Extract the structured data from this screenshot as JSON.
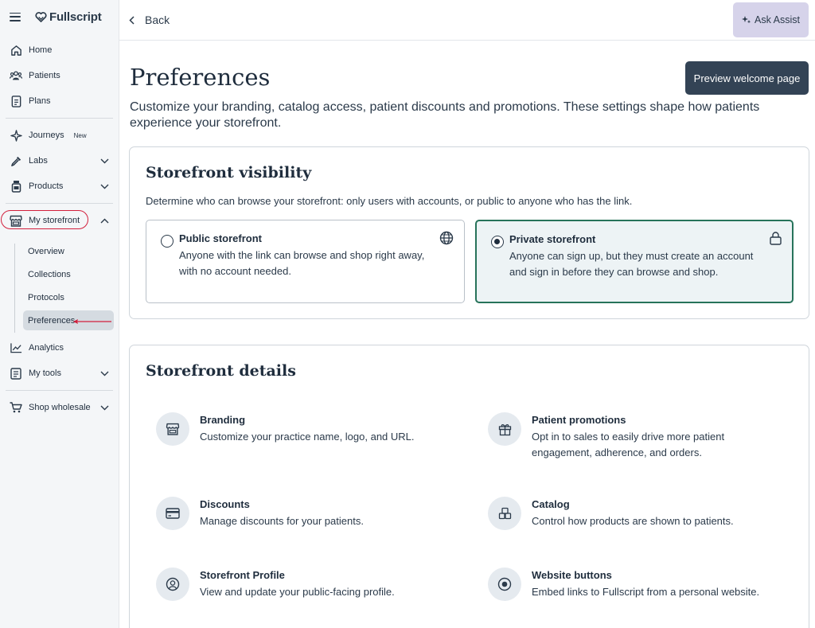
{
  "app": {
    "logo_text": "Fullscript"
  },
  "sidebar": {
    "items": [
      {
        "label": "Home",
        "icon": "home-icon"
      },
      {
        "label": "Patients",
        "icon": "users-icon"
      },
      {
        "label": "Plans",
        "icon": "document-icon"
      },
      {
        "label": "Journeys",
        "icon": "sparkle-icon",
        "badge": "New"
      },
      {
        "label": "Labs",
        "icon": "pipette-icon"
      },
      {
        "label": "Products",
        "icon": "bottle-icon"
      },
      {
        "label": "My storefront",
        "icon": "storefront-icon"
      },
      {
        "label": "Analytics",
        "icon": "line-chart-icon"
      },
      {
        "label": "My tools",
        "icon": "tools-icon"
      },
      {
        "label": "Shop wholesale",
        "icon": "cart-icon"
      }
    ],
    "storefront_sub": [
      "Overview",
      "Collections",
      "Protocols",
      "Preferences"
    ]
  },
  "header": {
    "back_label": "Back",
    "assist_label": "Ask Assist"
  },
  "main": {
    "title": "Preferences",
    "preview_button": "Preview welcome page",
    "description": "Customize your branding, catalog access, patient discounts and promotions. These settings shape how patients experience your storefront."
  },
  "visibility": {
    "title": "Storefront visibility",
    "subtitle": "Determine who can browse your storefront: only users with accounts, or public to anyone who has the link.",
    "selected": "private",
    "options": [
      {
        "title": "Public storefront",
        "desc": "Anyone with the link can browse and shop right away, with no account needed.",
        "icon": "globe-icon"
      },
      {
        "title": "Private storefront",
        "desc": "Anyone can sign up, but they must create an account and sign in before they can browse and shop.",
        "icon": "lock-icon"
      }
    ]
  },
  "details": {
    "title": "Storefront details",
    "items": [
      {
        "title": "Branding",
        "desc": "Customize your practice name, logo, and URL.",
        "icon": "storefront-icon"
      },
      {
        "title": "Patient promotions",
        "desc": "Opt in to sales to easily drive more patient engagement, adherence, and orders.",
        "icon": "gift-icon"
      },
      {
        "title": "Discounts",
        "desc": "Manage discounts for your patients.",
        "icon": "credit-card-icon"
      },
      {
        "title": "Catalog",
        "desc": "Control how products are shown to patients.",
        "icon": "catalog-icon"
      },
      {
        "title": "Storefront Profile",
        "desc": "View and update your public-facing profile.",
        "icon": "profile-icon"
      },
      {
        "title": "Website buttons",
        "desc": "Embed links to Fullscript from a personal website.",
        "icon": "target-icon"
      }
    ]
  }
}
